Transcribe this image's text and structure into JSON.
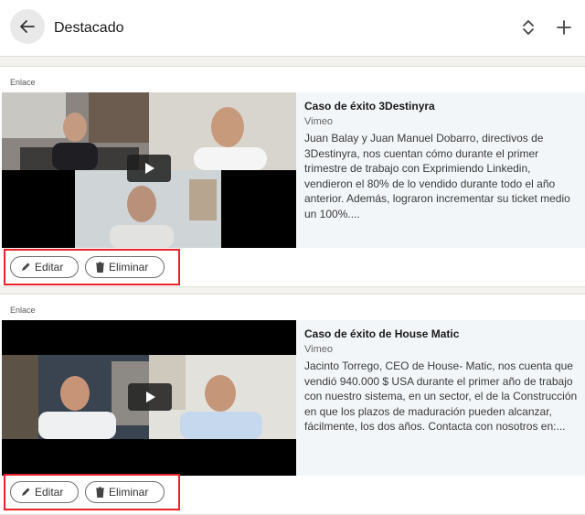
{
  "header": {
    "title": "Destacado"
  },
  "items": [
    {
      "type_label": "Enlace",
      "title": "Caso de éxito 3Destinyra",
      "source": "Vimeo",
      "description": "Juan Balay y Juan Manuel Dobarro, directivos de 3Destinyra, nos cuentan cómo durante el primer trimestre de trabajo con Exprimiendo Linkedin, vendieron el 80% de lo vendido durante todo el año anterior. Además, lograron incrementar su ticket medio un 100%....",
      "edit_label": "Editar",
      "delete_label": "Eliminar"
    },
    {
      "type_label": "Enlace",
      "title": "Caso de éxito de House Matic",
      "source": "Vimeo",
      "description": "Jacinto Torrego, CEO de House- Matic, nos cuenta que vendió 940.000 $ USA durante el primer año de trabajo con nuestro sistema, en un sector, el de la Construcción en que los plazos de maduración pueden alcanzar, fácilmente, los dos años. Contacta con nosotros en:...",
      "edit_label": "Editar",
      "delete_label": "Eliminar"
    }
  ],
  "colors": {
    "highlight_border": "#e8212b",
    "info_background": "#f3f6f8"
  }
}
